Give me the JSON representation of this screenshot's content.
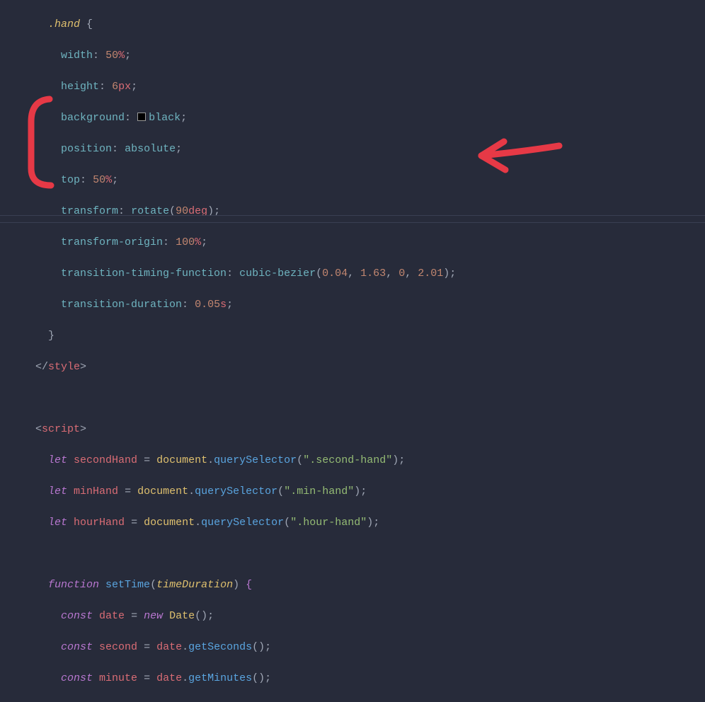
{
  "code": {
    "css_selector": ".hand",
    "decls": [
      {
        "prop": "width",
        "num": "50",
        "unit": "%"
      },
      {
        "prop": "height",
        "num": "6",
        "unit": "px"
      },
      {
        "prop": "background",
        "color_name": "black"
      },
      {
        "prop": "position",
        "value": "absolute"
      },
      {
        "prop": "top",
        "num": "50",
        "unit": "%"
      },
      {
        "prop": "transform",
        "func": "rotate",
        "arg_num": "90",
        "arg_unit": "deg"
      },
      {
        "prop": "transform-origin",
        "num": "100",
        "unit": "%"
      },
      {
        "prop": "transition-timing-function",
        "func": "cubic-bezier",
        "args": [
          "0.04",
          "1.63",
          "0",
          "2.01"
        ]
      },
      {
        "prop": "transition-duration",
        "num": "0.05",
        "unit": "s"
      }
    ],
    "close_tag": "style",
    "open_tag": "script",
    "js": {
      "var1_kw": "let",
      "var1": "secondHand",
      "eq": "=",
      "doc": "document",
      "qs": "querySelector",
      "sel1": "\".second-hand\"",
      "var2_kw": "let",
      "var2": "minHand",
      "sel2": "\".min-hand\"",
      "var3_kw": "let",
      "var3": "hourHand",
      "sel3": "\".hour-hand\"",
      "fn_kw": "function",
      "fn_name": "setTime",
      "fn_param": "timeDuration",
      "l1_kw": "const",
      "l1_var": "date",
      "l1_new": "new",
      "l1_cls": "Date",
      "l2_kw": "const",
      "l2_var": "second",
      "l2_obj": "date",
      "l2_meth": "getSeconds",
      "l3_kw": "const",
      "l3_var": "minute",
      "l3_obj": "date",
      "l3_meth": "getMinutes"
    }
  },
  "annotation": {
    "type": "arrow-and-bracket",
    "color": "#e63946",
    "description": "red hand-drawn bracket highlighting last four CSS lines and arrow pointing at cubic-bezier line"
  }
}
